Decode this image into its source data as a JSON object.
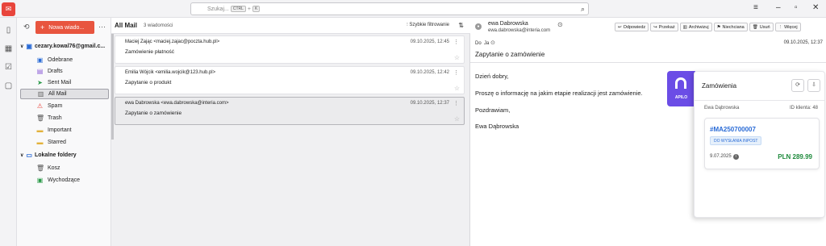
{
  "search": {
    "placeholder": "Szukaj...",
    "kbd1": "CTRL",
    "plus": "+",
    "kbd2": "K"
  },
  "folders": {
    "new_label": "Nowa wiado...",
    "account": "cezary.kowal76@gmail.c...",
    "items": [
      "Odebrane",
      "Drafts",
      "Sent Mail",
      "All Mail",
      "Spam",
      "Trash",
      "Important",
      "Starred"
    ],
    "local": "Lokalne foldery",
    "local_items": [
      "Kosz",
      "Wychodzące"
    ]
  },
  "list": {
    "title": "All Mail",
    "count": "3 wiadomości",
    "quick_filter": "Szybkie filtrowanie",
    "messages": [
      {
        "from": "Maciej Zając <maciej.zajac@poczta.hub.pl>",
        "subject": "Zamówienie płatność",
        "date": "09.10.2025, 12:45"
      },
      {
        "from": "Emilia Wójcik <emilia.wojcik@123.hub.pl>",
        "subject": "Zapytanie o produkt",
        "date": "09.10.2025, 12:42"
      },
      {
        "from": "ewa Dabrowska <ewa.dabrowska@interia.com>",
        "subject": "Zapytanie o zamówienie",
        "date": "09.10.2025, 12:37"
      }
    ]
  },
  "reader": {
    "sender": "ewa Dabrowska",
    "email": "ewa.dabrowska@interia.com",
    "to_label": "Do",
    "to_value": "Ja",
    "date": "09.10.2025, 12:37",
    "subject": "Zapytanie o zamówienie",
    "actions": [
      "Odpowiedz",
      "Przekaż",
      "Archiwizuj",
      "Niechciana",
      "Usuń",
      "Więcej"
    ],
    "body": [
      "Dzień dobry,",
      "Proszę o informację na jakim etapie realizacji jest zamówienie.",
      "Pozdrawiam,",
      "Ewa Dąbrowska"
    ]
  },
  "panel": {
    "brand": "APILO",
    "title": "Zamówienia",
    "customer": "Ewa Dąbrowska",
    "client_id": "ID klienta: 48",
    "order_no": "#MA250700007",
    "status": "DO WYSŁANIA INPOST",
    "order_date": "9.07.2025",
    "price": "PLN 289.99"
  },
  "colors": {
    "accent": "#e8553f",
    "apilo": "#6b4de6",
    "link": "#2a6bd6",
    "price": "#1e8a3c"
  }
}
